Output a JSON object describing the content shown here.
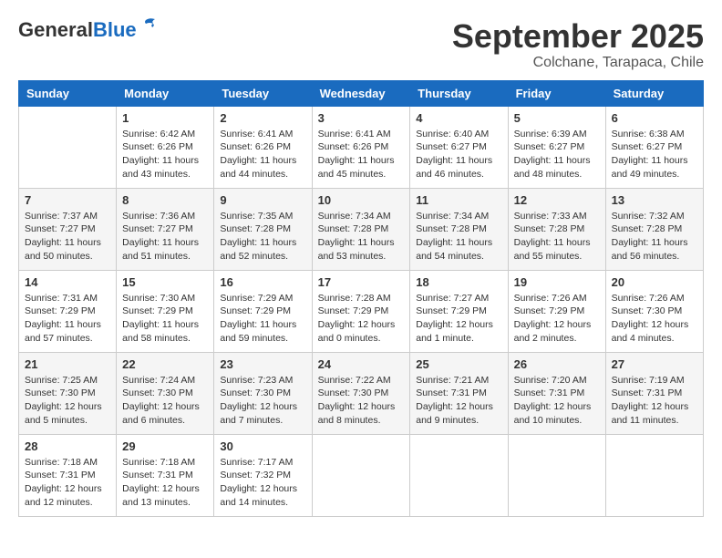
{
  "logo": {
    "general": "General",
    "blue": "Blue"
  },
  "title": {
    "month": "September 2025",
    "location": "Colchane, Tarapaca, Chile"
  },
  "weekdays": [
    "Sunday",
    "Monday",
    "Tuesday",
    "Wednesday",
    "Thursday",
    "Friday",
    "Saturday"
  ],
  "weeks": [
    [
      {
        "day": "",
        "info": ""
      },
      {
        "day": "1",
        "info": "Sunrise: 6:42 AM\nSunset: 6:26 PM\nDaylight: 11 hours\nand 43 minutes."
      },
      {
        "day": "2",
        "info": "Sunrise: 6:41 AM\nSunset: 6:26 PM\nDaylight: 11 hours\nand 44 minutes."
      },
      {
        "day": "3",
        "info": "Sunrise: 6:41 AM\nSunset: 6:26 PM\nDaylight: 11 hours\nand 45 minutes."
      },
      {
        "day": "4",
        "info": "Sunrise: 6:40 AM\nSunset: 6:27 PM\nDaylight: 11 hours\nand 46 minutes."
      },
      {
        "day": "5",
        "info": "Sunrise: 6:39 AM\nSunset: 6:27 PM\nDaylight: 11 hours\nand 48 minutes."
      },
      {
        "day": "6",
        "info": "Sunrise: 6:38 AM\nSunset: 6:27 PM\nDaylight: 11 hours\nand 49 minutes."
      }
    ],
    [
      {
        "day": "7",
        "info": "Sunrise: 7:37 AM\nSunset: 7:27 PM\nDaylight: 11 hours\nand 50 minutes."
      },
      {
        "day": "8",
        "info": "Sunrise: 7:36 AM\nSunset: 7:27 PM\nDaylight: 11 hours\nand 51 minutes."
      },
      {
        "day": "9",
        "info": "Sunrise: 7:35 AM\nSunset: 7:28 PM\nDaylight: 11 hours\nand 52 minutes."
      },
      {
        "day": "10",
        "info": "Sunrise: 7:34 AM\nSunset: 7:28 PM\nDaylight: 11 hours\nand 53 minutes."
      },
      {
        "day": "11",
        "info": "Sunrise: 7:34 AM\nSunset: 7:28 PM\nDaylight: 11 hours\nand 54 minutes."
      },
      {
        "day": "12",
        "info": "Sunrise: 7:33 AM\nSunset: 7:28 PM\nDaylight: 11 hours\nand 55 minutes."
      },
      {
        "day": "13",
        "info": "Sunrise: 7:32 AM\nSunset: 7:28 PM\nDaylight: 11 hours\nand 56 minutes."
      }
    ],
    [
      {
        "day": "14",
        "info": "Sunrise: 7:31 AM\nSunset: 7:29 PM\nDaylight: 11 hours\nand 57 minutes."
      },
      {
        "day": "15",
        "info": "Sunrise: 7:30 AM\nSunset: 7:29 PM\nDaylight: 11 hours\nand 58 minutes."
      },
      {
        "day": "16",
        "info": "Sunrise: 7:29 AM\nSunset: 7:29 PM\nDaylight: 11 hours\nand 59 minutes."
      },
      {
        "day": "17",
        "info": "Sunrise: 7:28 AM\nSunset: 7:29 PM\nDaylight: 12 hours\nand 0 minutes."
      },
      {
        "day": "18",
        "info": "Sunrise: 7:27 AM\nSunset: 7:29 PM\nDaylight: 12 hours\nand 1 minute."
      },
      {
        "day": "19",
        "info": "Sunrise: 7:26 AM\nSunset: 7:29 PM\nDaylight: 12 hours\nand 2 minutes."
      },
      {
        "day": "20",
        "info": "Sunrise: 7:26 AM\nSunset: 7:30 PM\nDaylight: 12 hours\nand 4 minutes."
      }
    ],
    [
      {
        "day": "21",
        "info": "Sunrise: 7:25 AM\nSunset: 7:30 PM\nDaylight: 12 hours\nand 5 minutes."
      },
      {
        "day": "22",
        "info": "Sunrise: 7:24 AM\nSunset: 7:30 PM\nDaylight: 12 hours\nand 6 minutes."
      },
      {
        "day": "23",
        "info": "Sunrise: 7:23 AM\nSunset: 7:30 PM\nDaylight: 12 hours\nand 7 minutes."
      },
      {
        "day": "24",
        "info": "Sunrise: 7:22 AM\nSunset: 7:30 PM\nDaylight: 12 hours\nand 8 minutes."
      },
      {
        "day": "25",
        "info": "Sunrise: 7:21 AM\nSunset: 7:31 PM\nDaylight: 12 hours\nand 9 minutes."
      },
      {
        "day": "26",
        "info": "Sunrise: 7:20 AM\nSunset: 7:31 PM\nDaylight: 12 hours\nand 10 minutes."
      },
      {
        "day": "27",
        "info": "Sunrise: 7:19 AM\nSunset: 7:31 PM\nDaylight: 12 hours\nand 11 minutes."
      }
    ],
    [
      {
        "day": "28",
        "info": "Sunrise: 7:18 AM\nSunset: 7:31 PM\nDaylight: 12 hours\nand 12 minutes."
      },
      {
        "day": "29",
        "info": "Sunrise: 7:18 AM\nSunset: 7:31 PM\nDaylight: 12 hours\nand 13 minutes."
      },
      {
        "day": "30",
        "info": "Sunrise: 7:17 AM\nSunset: 7:32 PM\nDaylight: 12 hours\nand 14 minutes."
      },
      {
        "day": "",
        "info": ""
      },
      {
        "day": "",
        "info": ""
      },
      {
        "day": "",
        "info": ""
      },
      {
        "day": "",
        "info": ""
      }
    ]
  ]
}
